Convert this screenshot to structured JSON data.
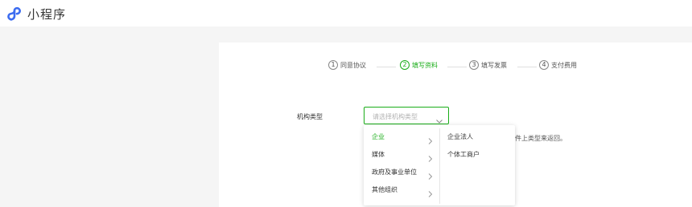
{
  "app": {
    "title": "小程序",
    "logo_icon": "miniprogram-logo-icon"
  },
  "steps": [
    {
      "num": "1",
      "label": "同意协议",
      "active": false
    },
    {
      "num": "2",
      "label": "填写资料",
      "active": true
    },
    {
      "num": "3",
      "label": "填写发票",
      "active": false
    },
    {
      "num": "4",
      "label": "支付费用",
      "active": false
    }
  ],
  "form": {
    "org_type_label": "机构类型",
    "org_type_placeholder": "请选择机构类型"
  },
  "hint": "件上类型来返回。",
  "dropdown": {
    "categories": [
      "企业",
      "媒体",
      "政府及事业单位",
      "其他组织"
    ],
    "selected_category": "企业",
    "subtypes": [
      "企业法人",
      "个体工商户"
    ]
  },
  "colors": {
    "accent": "#1aad19",
    "logo": "#3c6cf0"
  }
}
